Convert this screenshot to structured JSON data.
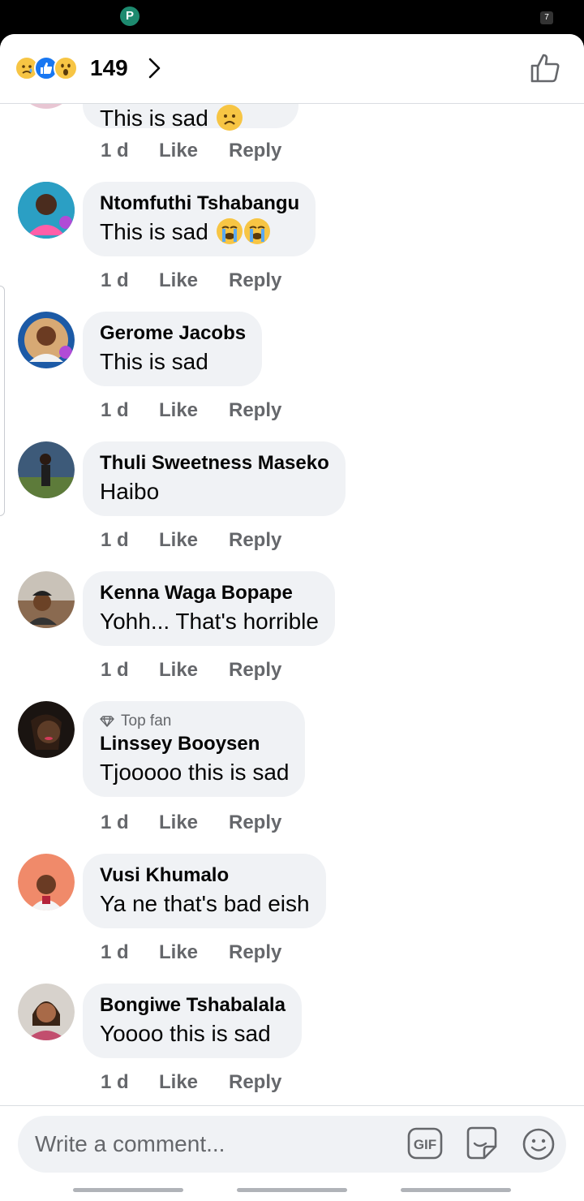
{
  "status_bar": {
    "app_icon_glyph": "P",
    "right_icon_glyph": "7"
  },
  "header": {
    "reaction_icons": [
      "sad-reaction-icon",
      "like-reaction-icon",
      "wow-reaction-icon"
    ],
    "reaction_count": "149",
    "chevron_icon": "chevron-right-icon",
    "like_icon": "thumbs-up-outline-icon"
  },
  "comments": [
    {
      "name": "",
      "text": "This is sad",
      "emojis": [
        "worried-face"
      ],
      "time": "1 d",
      "like": "Like",
      "reply": "Reply",
      "top_fan": ""
    },
    {
      "name": "Ntomfuthi Tshabangu",
      "text": "This is sad",
      "emojis": [
        "loudly-crying-face",
        "loudly-crying-face"
      ],
      "time": "1 d",
      "like": "Like",
      "reply": "Reply",
      "top_fan": ""
    },
    {
      "name": "Gerome Jacobs",
      "text": "This is sad",
      "emojis": [],
      "time": "1 d",
      "like": "Like",
      "reply": "Reply",
      "top_fan": ""
    },
    {
      "name": "Thuli Sweetness Maseko",
      "text": "Haibo",
      "emojis": [],
      "time": "1 d",
      "like": "Like",
      "reply": "Reply",
      "top_fan": ""
    },
    {
      "name": "Kenna Waga Bopape",
      "text": "Yohh... That's horrible",
      "emojis": [],
      "time": "1 d",
      "like": "Like",
      "reply": "Reply",
      "top_fan": ""
    },
    {
      "name": "Linssey Booysen",
      "text": "Tjooooo this is sad",
      "emojis": [],
      "time": "1 d",
      "like": "Like",
      "reply": "Reply",
      "top_fan": "Top fan"
    },
    {
      "name": "Vusi Khumalo",
      "text": "Ya ne that's bad eish",
      "emojis": [],
      "time": "1 d",
      "like": "Like",
      "reply": "Reply",
      "top_fan": ""
    },
    {
      "name": "Bongiwe Tshabalala",
      "text": "Yoooo this is sad",
      "emojis": [],
      "time": "1 d",
      "like": "Like",
      "reply": "Reply",
      "top_fan": ""
    }
  ],
  "composer": {
    "placeholder": "Write a comment...",
    "gif_label": "GIF",
    "sticker_icon": "sticker-icon",
    "emoji_icon": "smiley-face-icon"
  },
  "colors": {
    "bubble": "#f0f2f5",
    "meta_text": "#65676b",
    "like_blue": "#1877f2",
    "divider": "#dadde1"
  }
}
